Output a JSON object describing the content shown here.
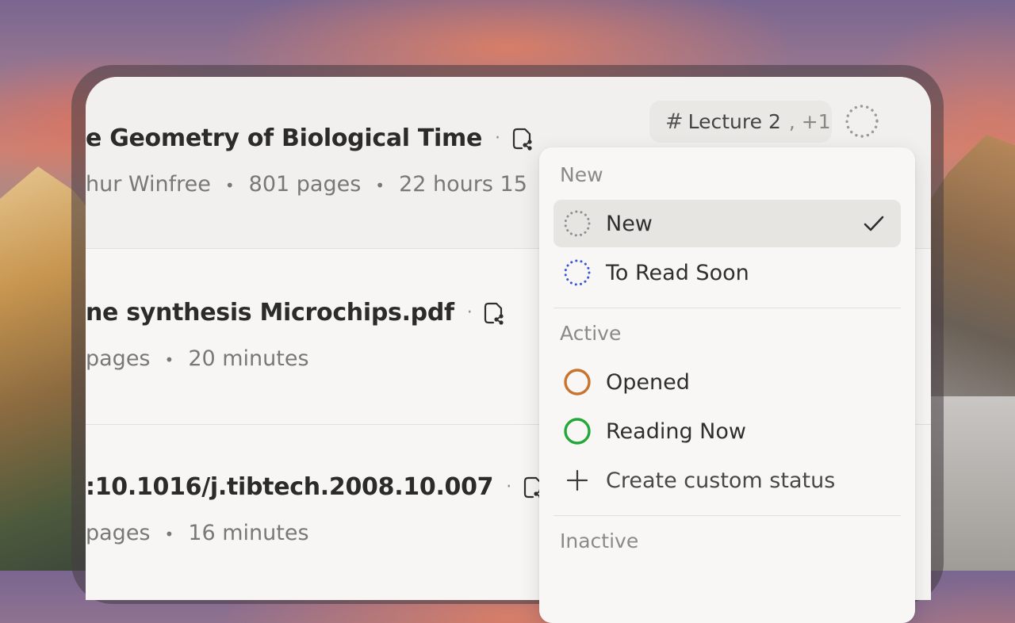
{
  "documents": [
    {
      "title": "e Geometry of Biological Time",
      "meta": [
        "hur Winfree",
        "801 pages",
        "22 hours 15"
      ]
    },
    {
      "title": "ne synthesis Microchips.pdf",
      "meta": [
        "pages",
        "20 minutes"
      ]
    },
    {
      "title": ":10.1016/j.tibtech.2008.10.007",
      "meta": [
        "pages",
        "16 minutes"
      ]
    }
  ],
  "tag_chip": {
    "hash": "#",
    "label": "Lecture 2",
    "more": ", +1"
  },
  "status_menu": {
    "sections": [
      {
        "label": "New"
      },
      {
        "label": "Active"
      },
      {
        "label": "Inactive"
      }
    ],
    "items": {
      "new": {
        "label": "New",
        "icon": "dotted-circle-gray-icon",
        "color": "#8e8e8e",
        "selected": true
      },
      "to_read_soon": {
        "label": "To Read Soon",
        "icon": "dotted-circle-blue-icon",
        "color": "#3a56d4"
      },
      "opened": {
        "label": "Opened",
        "icon": "circle-orange-icon",
        "color": "#c8742f"
      },
      "reading_now": {
        "label": "Reading Now",
        "icon": "circle-green-icon",
        "color": "#22a83a"
      },
      "create_custom": {
        "label": "Create custom status",
        "icon": "plus-icon"
      }
    }
  },
  "meta_separator": "•",
  "title_separator": "·"
}
